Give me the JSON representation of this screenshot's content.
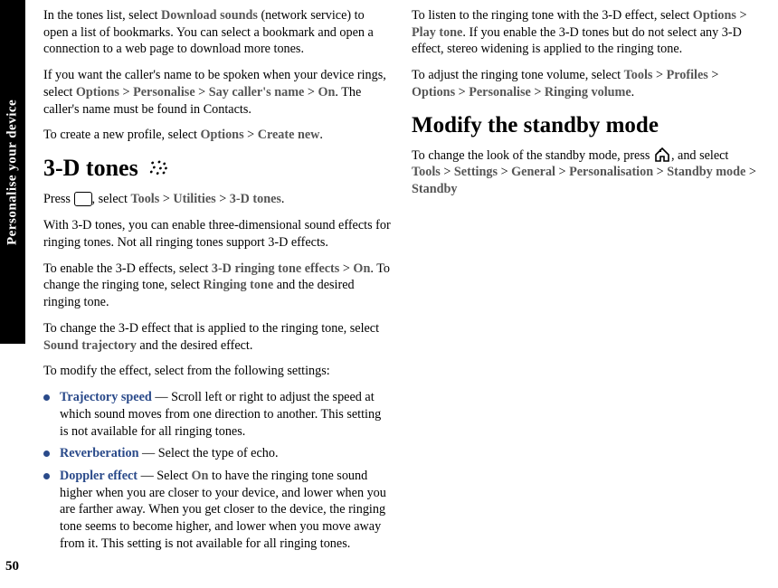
{
  "sideTab": "Personalise your device",
  "pageNumber": "50",
  "col": {
    "p1a": "In the tones list, select ",
    "p1b": "Download sounds",
    "p1c": " (network service) to open a list of bookmarks. You can select a bookmark and open a connection to a web page to download more tones.",
    "p2a": "If you want the caller's name to be spoken when your device rings, select ",
    "p2b": "Options",
    "p2c": "Personalise",
    "p2d": "Say caller's name",
    "p2e": "On",
    "p2f": ". The caller's name must be found in Contacts.",
    "p3a": "To create a new profile, select ",
    "p3b": "Options",
    "p3c": "Create new",
    "h1": "3-D tones",
    "p4a": "Press ",
    "p4b": ", select ",
    "p4c": "Tools",
    "p4d": "Utilities",
    "p4e": "3-D tones",
    "p5": "With 3-D tones, you can enable three-dimensional sound effects for ringing tones. Not all ringing tones support 3-D effects.",
    "p6a": "To enable the 3-D effects, select ",
    "p6b": "3-D ringing tone effects",
    "p6c": "On",
    "p6d": ". To change the ringing tone, select ",
    "p6e": "Ringing tone",
    "p6f": " and the desired ringing tone.",
    "p7a": "To change the 3-D effect that is applied to the ringing tone, select ",
    "p7b": "Sound trajectory",
    "p7c": " and the desired effect.",
    "p8": "To modify the effect, select from the following settings:",
    "b1a": "Trajectory speed",
    "b1b": " — Scroll left or right to adjust the speed at which sound moves from one direction to another. This setting is not available for all ringing tones.",
    "b2a": "Reverberation",
    "b2b": " — Select the type of echo.",
    "b3a": "Doppler effect",
    "b3b": " — Select ",
    "b3c": "On",
    "b3d": " to have the ringing tone sound higher when you are closer to your device, and lower when you are farther away. When you get closer to the device, the ringing tone seems to become higher, and lower when you move away from it. This setting is not available for all ringing tones.",
    "p9a": "To listen to the ringing tone with the 3-D effect, select ",
    "p9b": "Options",
    "p9c": "Play tone",
    "p9d": ". If you enable the 3-D tones but do not select any 3-D effect, stereo widening is applied to the ringing tone.",
    "p10a": "To adjust the ringing tone volume, select ",
    "p10b": "Tools",
    "p10c": "Profiles",
    "p10d": "Options",
    "p10e": "Personalise",
    "p10f": "Ringing volume",
    "h2": "Modify the standby mode",
    "p11a": "To change the look of the standby mode, press ",
    "p11b": ", and select ",
    "p11c": "Tools",
    "p11d": "Settings",
    "p11e": "General",
    "p11f": "Personalisation",
    "p11g": "Standby mode",
    "p11h": "Standby",
    "gt": " > "
  }
}
